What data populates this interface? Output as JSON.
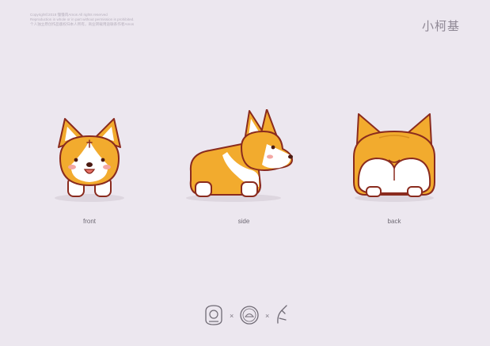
{
  "copyright": {
    "line1": "Copyright©2018 憧憧肉Amos All rights reserved",
    "line2": "Reproduction in whole or in part without permission is prohibited.",
    "line3": "个人独立原创作品版权归本人所有，商业转载用途联系作者Amos"
  },
  "title": "小柯基",
  "views": [
    {
      "label": "front"
    },
    {
      "label": "side"
    },
    {
      "label": "back"
    }
  ],
  "footer": {
    "separator": "×"
  },
  "colors": {
    "background": "#ece7ef",
    "fur_orange": "#f2ab2e",
    "fur_white": "#ffffff",
    "outline": "#8a2b1e",
    "blush": "#f3a7a3"
  },
  "icons": [
    "corgi-front-icon",
    "corgi-side-icon",
    "corgi-back-icon",
    "logo-badge-icon",
    "logo-round-icon",
    "logo-figure-icon"
  ]
}
